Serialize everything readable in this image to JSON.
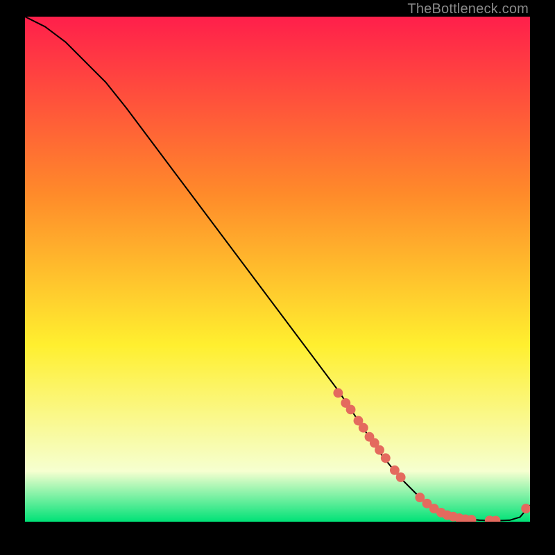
{
  "watermark": "TheBottleneck.com",
  "colors": {
    "grad_red": "#ff1f4b",
    "grad_orange": "#ff8a2a",
    "grad_yellow": "#ffef2f",
    "grad_pale": "#f6ffd0",
    "grad_green": "#00e277",
    "line": "#000000",
    "marker": "#e46a5e",
    "bg": "#000000"
  },
  "chart_data": {
    "type": "line",
    "title": "",
    "xlabel": "",
    "ylabel": "",
    "xlim": [
      0,
      100
    ],
    "ylim": [
      0,
      100
    ],
    "series": [
      {
        "name": "curve",
        "x": [
          0,
          4,
          8,
          12,
          16,
          20,
          26,
          32,
          38,
          44,
          50,
          56,
          62,
          66,
          70,
          74,
          78,
          81,
          84,
          87,
          90,
          93,
          96,
          98,
          100
        ],
        "y": [
          100,
          98,
          95,
          91,
          87,
          82,
          74,
          66,
          58,
          50,
          42,
          34,
          26,
          20,
          14,
          9,
          5,
          2.5,
          1.2,
          0.6,
          0.3,
          0.2,
          0.3,
          0.9,
          3.2
        ]
      }
    ],
    "markers": {
      "name": "highlight-points",
      "x": [
        62,
        63.5,
        64.5,
        66,
        67,
        68.2,
        69.2,
        70.2,
        71.4,
        73.2,
        74.4,
        78.2,
        79.6,
        81,
        82.4,
        83.6,
        84.8,
        86,
        87.2,
        88.4,
        92,
        93.2,
        99.2
      ],
      "y": [
        25.5,
        23.5,
        22.2,
        20.0,
        18.6,
        16.8,
        15.6,
        14.2,
        12.6,
        10.2,
        8.8,
        4.8,
        3.6,
        2.6,
        1.8,
        1.3,
        1.0,
        0.7,
        0.5,
        0.4,
        0.25,
        0.22,
        2.6
      ]
    },
    "gradient_stops": [
      {
        "offset": 0.0,
        "key": "grad_red"
      },
      {
        "offset": 0.35,
        "key": "grad_orange"
      },
      {
        "offset": 0.65,
        "key": "grad_yellow"
      },
      {
        "offset": 0.9,
        "key": "grad_pale"
      },
      {
        "offset": 1.0,
        "key": "grad_green"
      }
    ]
  }
}
